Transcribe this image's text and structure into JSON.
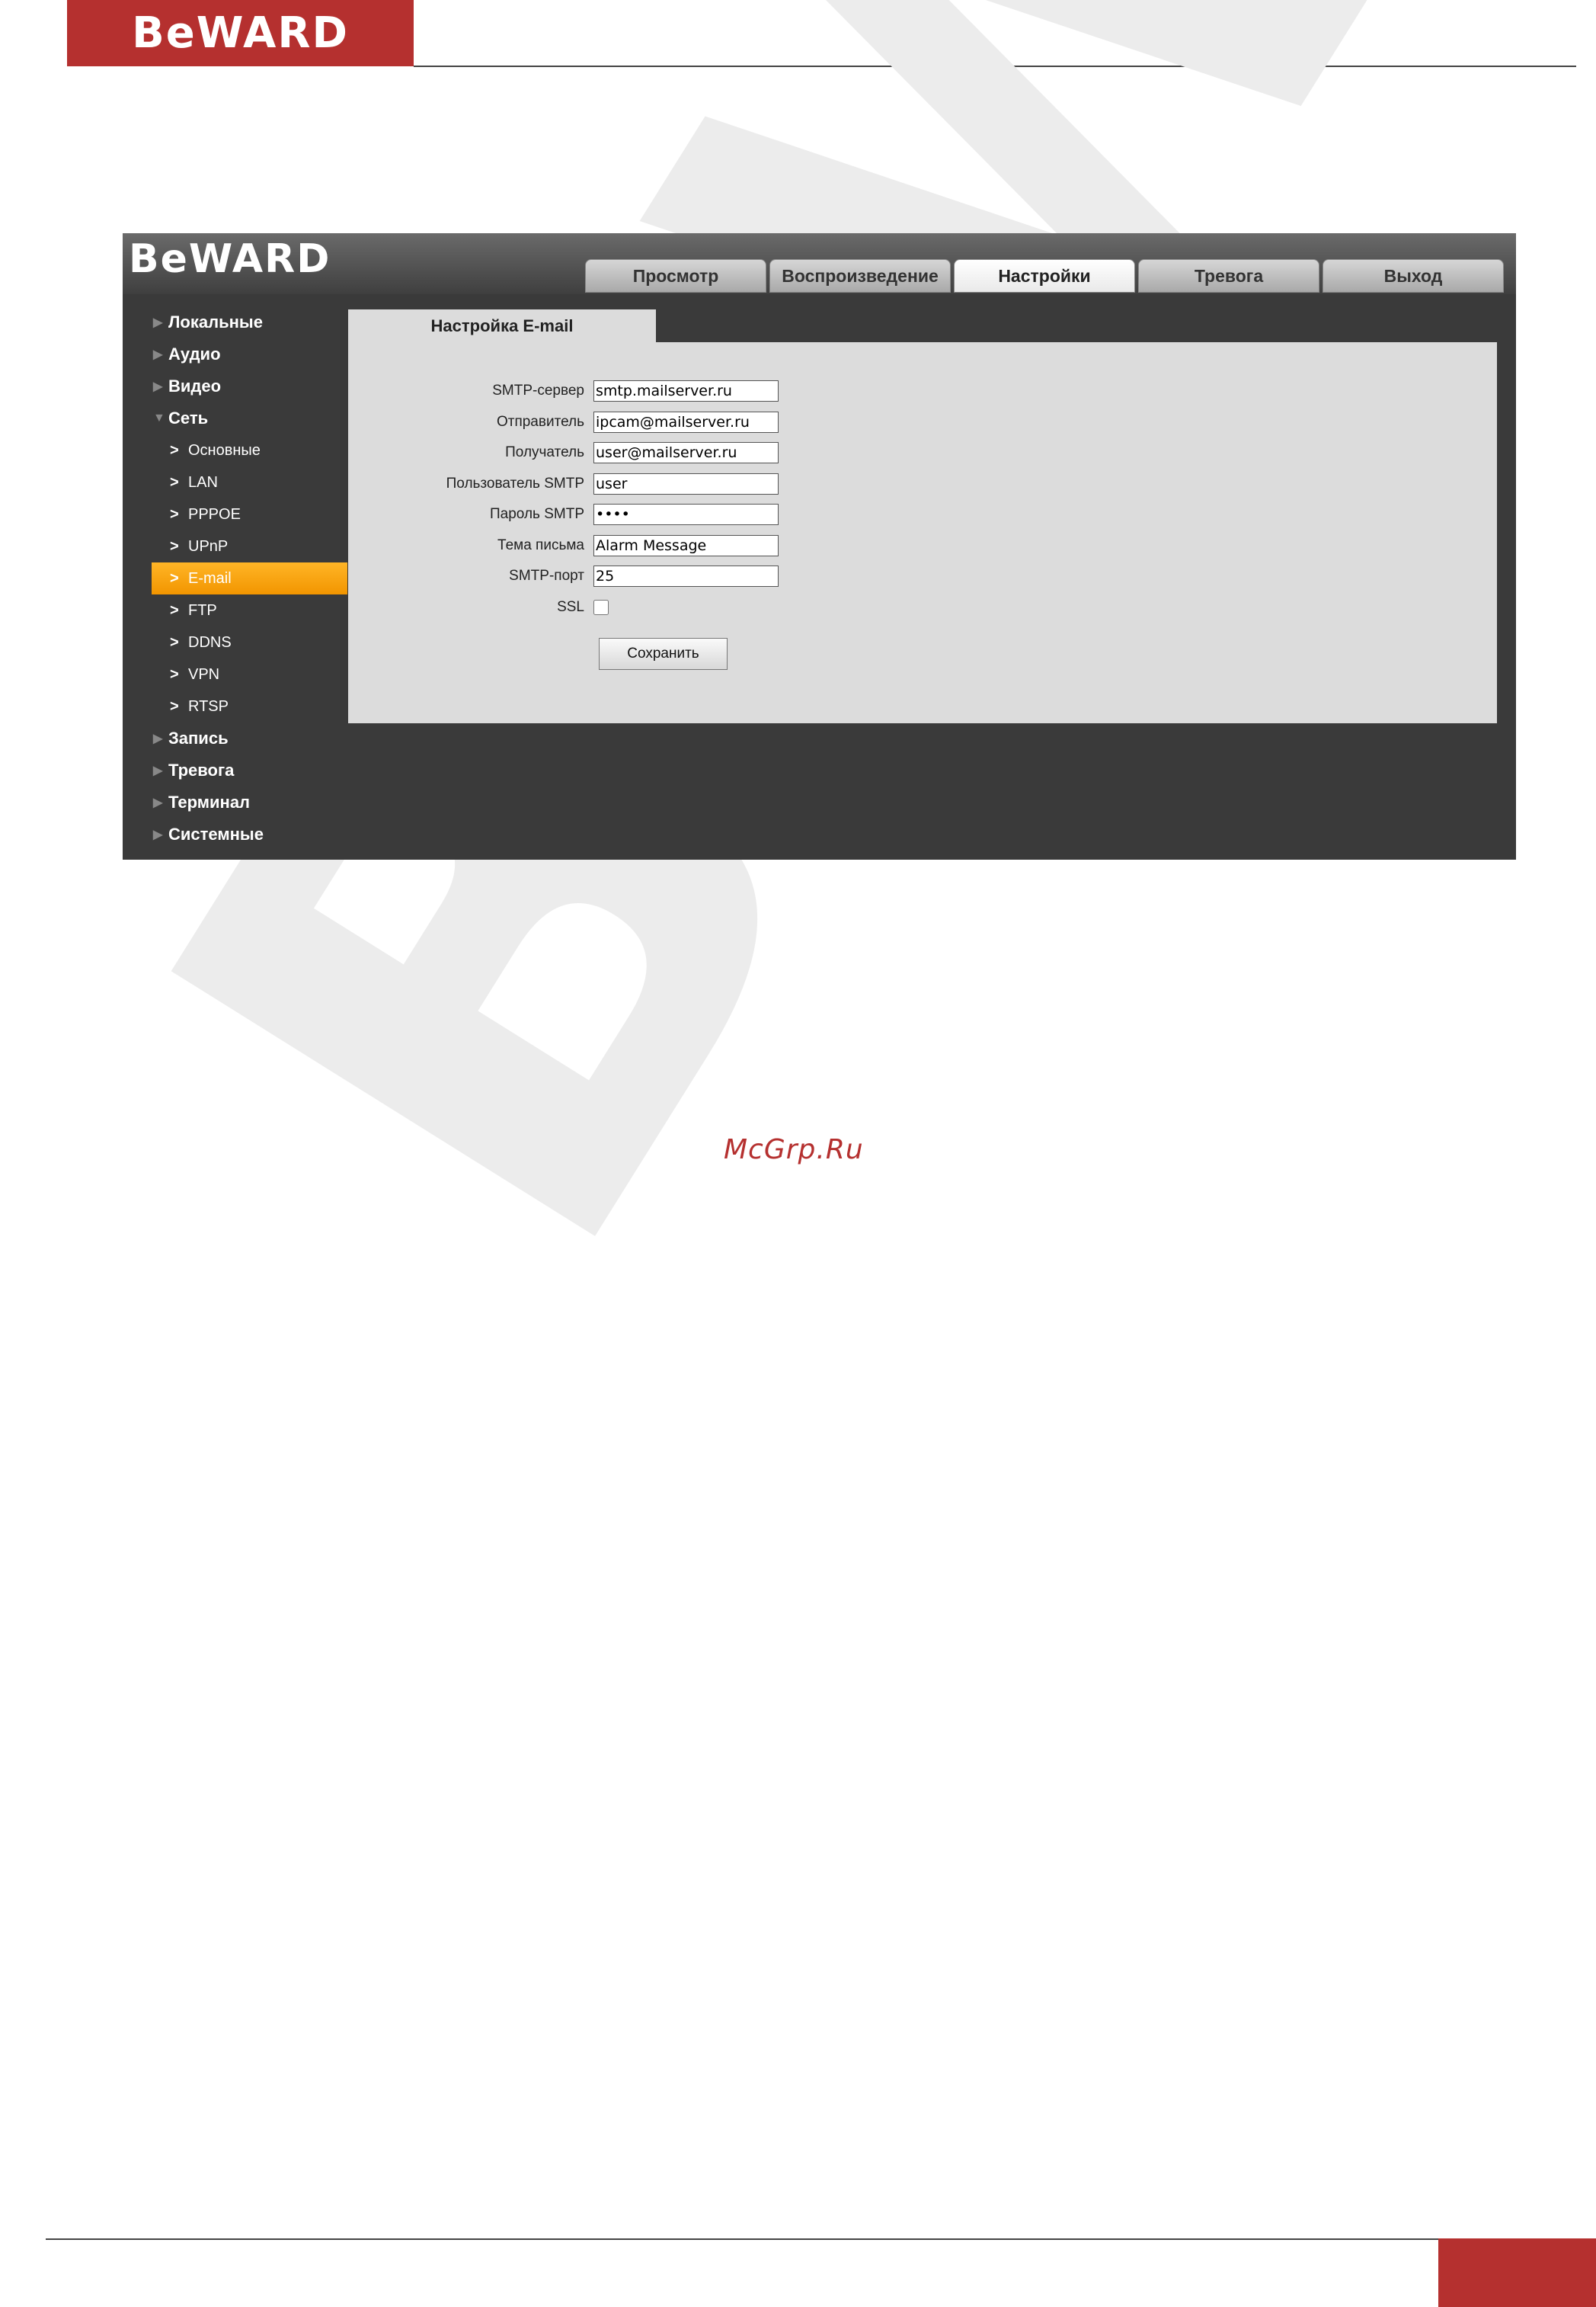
{
  "document": {
    "logo_text": "BeWARD",
    "site_mark": "McGrp.Ru"
  },
  "app": {
    "logo_text": "BeWARD",
    "tabs": [
      {
        "label": "Просмотр",
        "active": false
      },
      {
        "label": "Воспроизведение",
        "active": false
      },
      {
        "label": "Настройки",
        "active": true
      },
      {
        "label": "Тревога",
        "active": false
      },
      {
        "label": "Выход",
        "active": false
      }
    ],
    "sidebar": {
      "items": [
        {
          "label": "Локальные"
        },
        {
          "label": "Аудио"
        },
        {
          "label": "Видео"
        },
        {
          "label": "Сеть",
          "expanded": true
        },
        {
          "label": "Запись"
        },
        {
          "label": "Тревога"
        },
        {
          "label": "Терминал"
        },
        {
          "label": "Системные"
        }
      ],
      "network_sub": [
        {
          "label": "Основные"
        },
        {
          "label": "LAN"
        },
        {
          "label": "PPPOE"
        },
        {
          "label": "UPnP"
        },
        {
          "label": "E-mail",
          "active": true
        },
        {
          "label": "FTP"
        },
        {
          "label": "DDNS"
        },
        {
          "label": "VPN"
        },
        {
          "label": "RTSP"
        }
      ]
    },
    "panel": {
      "title": "Настройка E-mail",
      "fields": {
        "smtp_server": {
          "label": "SMTP-сервер",
          "value": "smtp.mailserver.ru"
        },
        "sender": {
          "label": "Отправитель",
          "value": "ipcam@mailserver.ru"
        },
        "recipient": {
          "label": "Получатель",
          "value": "user@mailserver.ru"
        },
        "smtp_user": {
          "label": "Пользователь SMTP",
          "value": "user"
        },
        "smtp_password": {
          "label": "Пароль SMTP",
          "value": "••••"
        },
        "subject": {
          "label": "Тема письма",
          "value": "Alarm Message"
        },
        "smtp_port": {
          "label": "SMTP-порт",
          "value": "25"
        },
        "ssl": {
          "label": "SSL",
          "checked": false
        }
      },
      "save_label": "Сохранить"
    },
    "colors": {
      "brand": "#b5302f",
      "active_menu": "#f29500",
      "background": "#3a3a3a",
      "panel": "#dcdcdc"
    }
  }
}
